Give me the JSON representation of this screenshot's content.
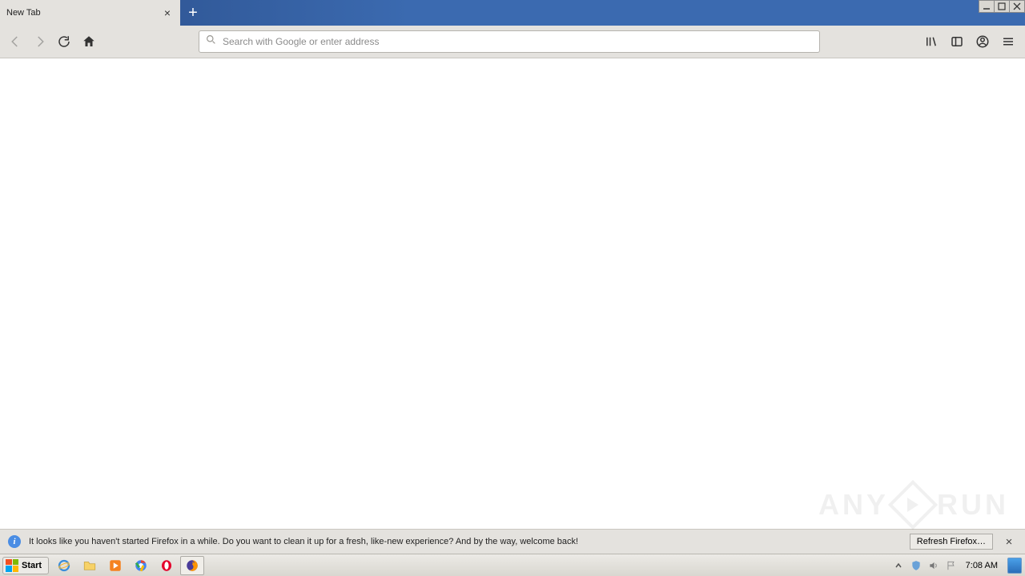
{
  "titlebar": {
    "tab_label": "New Tab"
  },
  "toolbar": {
    "search_placeholder": "Search with Google or enter address"
  },
  "notification": {
    "message": "It looks like you haven't started Firefox in a while. Do you want to clean it up for a fresh, like-new experience? And by the way, welcome back!",
    "button_label": "Refresh Firefox…"
  },
  "taskbar": {
    "start_label": "Start",
    "clock": "7:08 AM"
  },
  "watermark": {
    "left": "ANY",
    "right": "RUN"
  }
}
